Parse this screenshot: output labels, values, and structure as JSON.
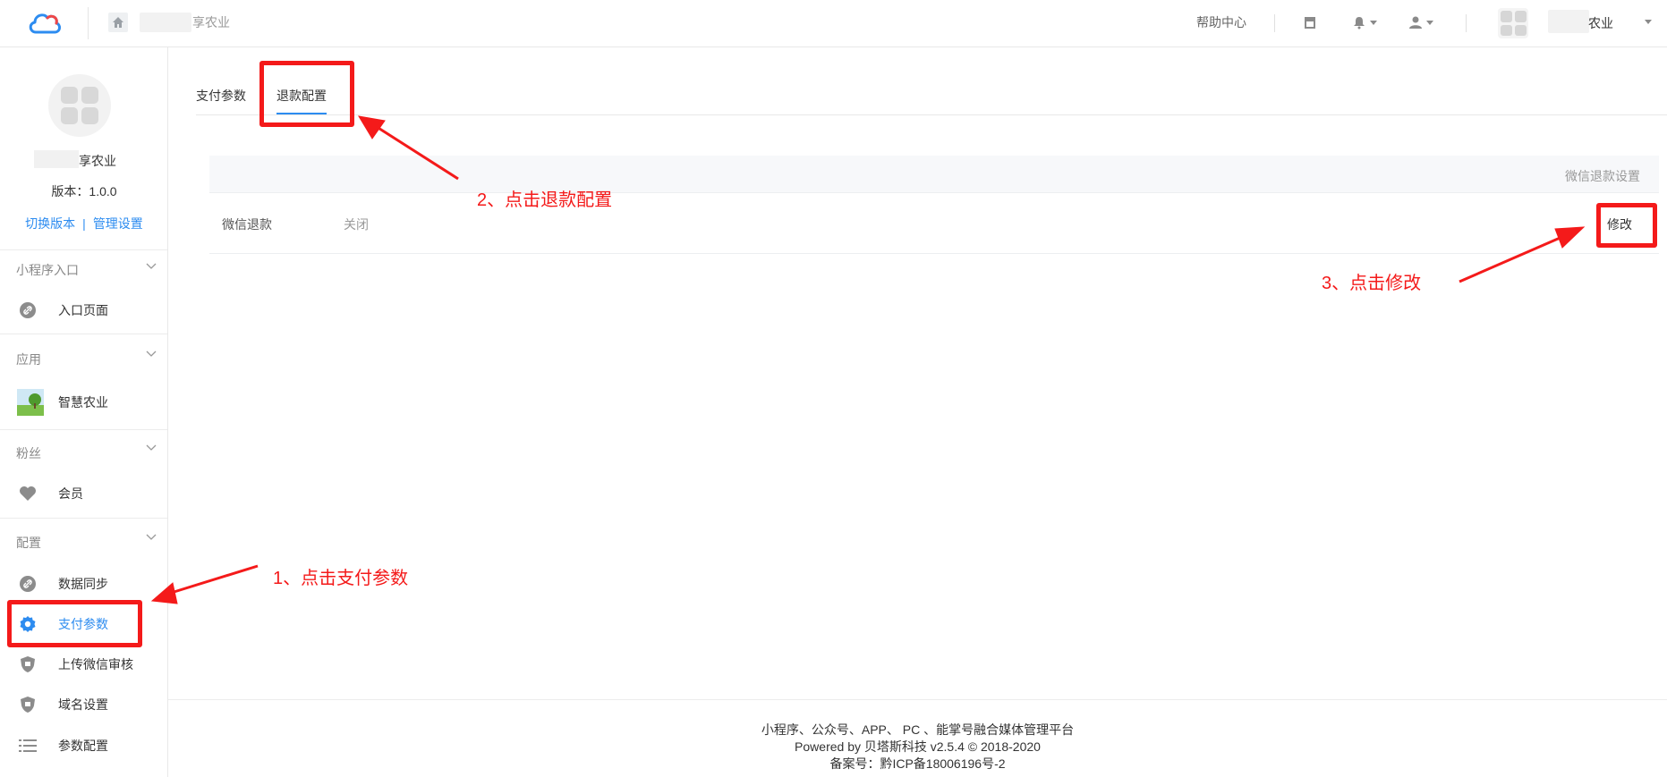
{
  "header": {
    "breadcrumb_suffix": "享农业",
    "help_center": "帮助中心",
    "tenant_name_suffix": "农业",
    "icons": [
      "home-icon",
      "store-icon",
      "bell-icon",
      "user-icon"
    ]
  },
  "sidebar": {
    "shop_name_suffix": "享农业",
    "version": "版本：1.0.0",
    "switch_version": "切换版本",
    "links_sep": "|",
    "manage_settings": "管理设置",
    "sections": [
      {
        "title": "小程序入口",
        "items": [
          {
            "label": "入口页面",
            "icon": "link-icon"
          }
        ]
      },
      {
        "title": "应用",
        "items": [
          {
            "label": "智慧农业",
            "icon": "app-thumbnail"
          }
        ]
      },
      {
        "title": "粉丝",
        "items": [
          {
            "label": "会员",
            "icon": "heart-icon"
          }
        ]
      },
      {
        "title": "配置",
        "items": [
          {
            "label": "数据同步",
            "icon": "link-icon"
          },
          {
            "label": "支付参数",
            "icon": "gear-icon",
            "active": true
          },
          {
            "label": "上传微信审核",
            "icon": "shield-icon"
          },
          {
            "label": "域名设置",
            "icon": "shield-icon"
          },
          {
            "label": "参数配置",
            "icon": "list-icon"
          }
        ]
      }
    ]
  },
  "main": {
    "tabs": [
      {
        "label": "支付参数"
      },
      {
        "label": "退款配置",
        "active": true
      }
    ],
    "table": {
      "header": "微信退款设置",
      "rows": [
        {
          "name": "微信退款",
          "status": "关闭",
          "action": "修改"
        }
      ]
    }
  },
  "footer": {
    "line1": "小程序、公众号、APP、 PC 、能掌号融合媒体管理平台",
    "line2": "Powered by 贝塔斯科技 v2.5.4 © 2018-2020",
    "line3": "备案号：黔ICP备18006196号-2"
  },
  "annotations": {
    "step1": "1、点击支付参数",
    "step2": "2、点击退款配置",
    "step3": "3、点击修改"
  },
  "colors": {
    "accent": "#2d8cf0",
    "annotation_red": "#f41a1a"
  }
}
